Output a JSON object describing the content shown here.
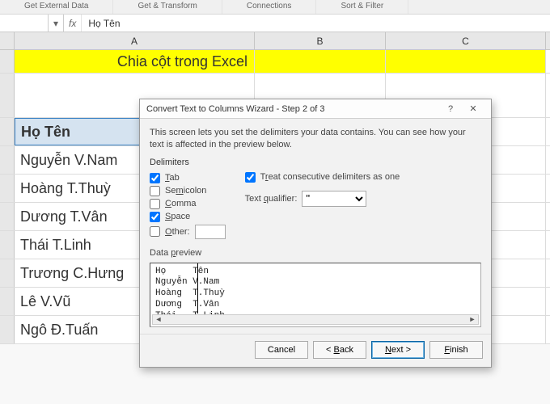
{
  "ribbon": {
    "groups": [
      "Get External Data",
      "Get & Transform",
      "Connections",
      "Sort & Filter"
    ]
  },
  "formula_bar": {
    "fx_label": "fx",
    "value": "Họ Tên"
  },
  "columns": [
    "A",
    "B",
    "C"
  ],
  "row1": {
    "text": "Chia cột trong Excel"
  },
  "data_rows": [
    "Họ Tên",
    "Nguyễn V.Nam",
    "Hoàng T.Thuỳ",
    "Dương T.Vân",
    "Thái T.Linh",
    "Trương C.Hưng",
    "Lê V.Vũ",
    "Ngô Đ.Tuấn"
  ],
  "dialog": {
    "title": "Convert Text to Columns Wizard - Step 2 of 3",
    "help": "?",
    "close": "✕",
    "description": "This screen lets you set the delimiters your data contains.  You can see how your text is affected in the preview below.",
    "delimiters_label": "Delimiters",
    "delimiters": {
      "tab": {
        "label": "Tab",
        "key": "T",
        "checked": true
      },
      "semicolon": {
        "label": "Semicolon",
        "key": "S",
        "checked": false
      },
      "comma": {
        "label": "Comma",
        "key": "C",
        "checked": false
      },
      "space": {
        "label": "Space",
        "key": "S",
        "checked": true
      },
      "other": {
        "label": "Other:",
        "key": "O",
        "checked": false,
        "value": ""
      }
    },
    "treat_consecutive": {
      "label": "Treat consecutive delimiters as one",
      "checked": true
    },
    "text_qualifier": {
      "label": "Text qualifier:",
      "value": "\""
    },
    "preview_label": "Data preview",
    "preview_rows": [
      [
        "Họ",
        "Tên"
      ],
      [
        "Nguyễn",
        "V.Nam"
      ],
      [
        "Hoàng",
        "T.Thuỳ"
      ],
      [
        "Dương",
        "T.Vân"
      ],
      [
        "Thái",
        "T.Linh"
      ]
    ],
    "buttons": {
      "cancel": "Cancel",
      "back": "< Back",
      "next": "Next >",
      "finish": "Finish"
    }
  }
}
